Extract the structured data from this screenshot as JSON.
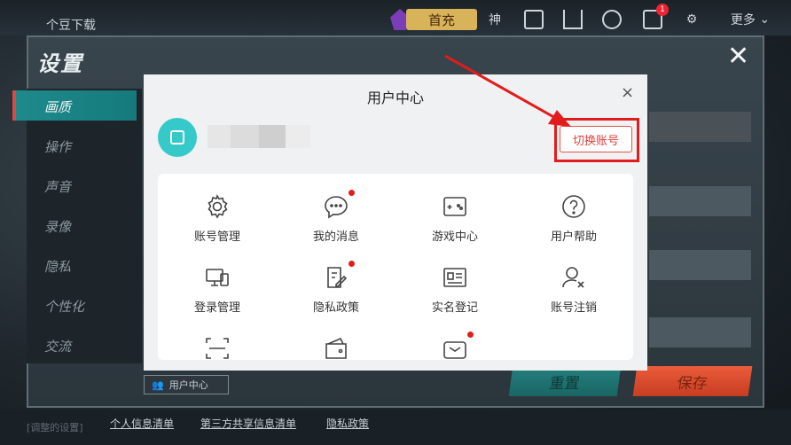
{
  "topbar": {
    "download_text": "个豆下载",
    "shouchong_label": "首充",
    "shen_label": "神",
    "more_label": "更多",
    "notify_count": "1"
  },
  "settings": {
    "title": "设置",
    "sidebar": [
      {
        "label": "画质",
        "active": true
      },
      {
        "label": "操作"
      },
      {
        "label": "声音"
      },
      {
        "label": "录像"
      },
      {
        "label": "隐私"
      },
      {
        "label": "个性化"
      },
      {
        "label": "交流"
      }
    ],
    "reset_label": "重置",
    "save_label": "保存",
    "user_center_tag": "用户中心"
  },
  "footer": {
    "links": [
      "个人信息清单",
      "第三方共享信息清单",
      "隐私政策"
    ],
    "faint_text": "[调整的设置]"
  },
  "modal": {
    "title": "用户中心",
    "close_glyph": "×",
    "switch_account_label": "切换账号",
    "items": [
      {
        "label": "账号管理",
        "icon": "gear-icon",
        "dot": false
      },
      {
        "label": "我的消息",
        "icon": "message-icon",
        "dot": true
      },
      {
        "label": "游戏中心",
        "icon": "gamepad-icon",
        "dot": false
      },
      {
        "label": "用户帮助",
        "icon": "help-icon",
        "dot": false
      },
      {
        "label": "登录管理",
        "icon": "devices-icon",
        "dot": false
      },
      {
        "label": "隐私政策",
        "icon": "privacy-doc-icon",
        "dot": true
      },
      {
        "label": "实名登记",
        "icon": "id-card-icon",
        "dot": false
      },
      {
        "label": "账号注销",
        "icon": "user-remove-icon",
        "dot": false
      }
    ],
    "partial_items": [
      {
        "icon": "scan-icon",
        "dot": false
      },
      {
        "icon": "wallet-icon",
        "dot": false
      },
      {
        "icon": "gift-box-icon",
        "dot": true
      }
    ]
  },
  "colors": {
    "accent_teal": "#36c9c9",
    "highlight_red": "#e21c1c",
    "save_orange": "#ea5b3a",
    "reset_teal": "#24807e"
  }
}
